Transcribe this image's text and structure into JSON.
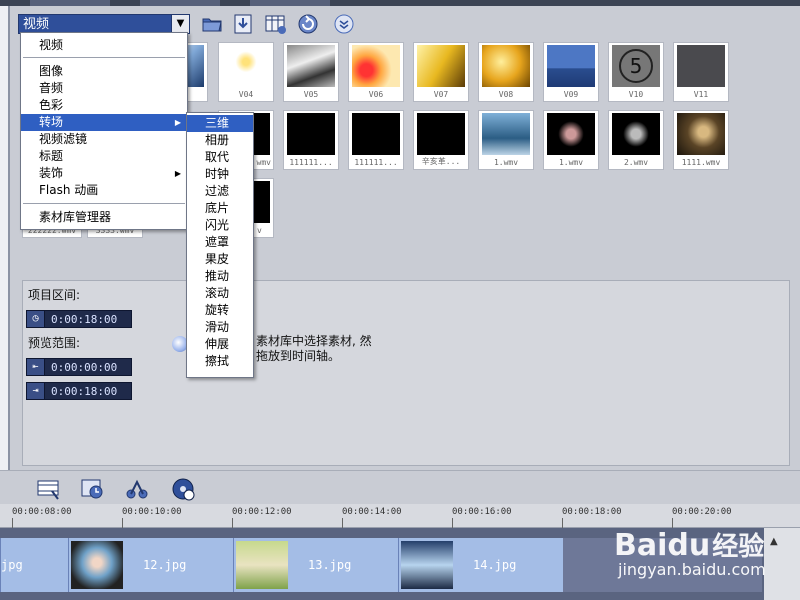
{
  "library": {
    "category": "视频",
    "thumbs_row1": [
      "V04",
      "V05",
      "V06",
      "V07",
      "V08",
      "V09",
      "V10",
      "V11"
    ],
    "thumbs_row2": [
      "111111...",
      "111111...",
      "辛亥革...",
      "1.wmv",
      "1.wmv",
      "2.wmv",
      "1111.wmv"
    ],
    "partial_labels": {
      "row2_left": "wmv",
      "row3_a": "222222.wmv",
      "row3_b": "3333.wmv",
      "row3_c": "v"
    },
    "v10_number": "5"
  },
  "category_menu": {
    "items": [
      {
        "label": "视频"
      },
      {
        "label": "图像"
      },
      {
        "label": "音频"
      },
      {
        "label": "色彩"
      },
      {
        "label": "转场",
        "submenu": true,
        "selected": true
      },
      {
        "label": "视频滤镜"
      },
      {
        "label": "标题"
      },
      {
        "label": "装饰",
        "submenu": true
      },
      {
        "label": "Flash 动画"
      },
      {
        "label": "素材库管理器"
      }
    ]
  },
  "transition_submenu": {
    "items": [
      "三维",
      "相册",
      "取代",
      "时钟",
      "过滤",
      "底片",
      "闪光",
      "遮罩",
      "果皮",
      "推动",
      "滚动",
      "旋转",
      "滑动",
      "伸展",
      "擦拭"
    ],
    "selected": "三维"
  },
  "properties": {
    "duration_label": "项目区间:",
    "duration_value": "0:00:18:00",
    "preview_label": "预览范围:",
    "preview_start": "0:00:00:00",
    "preview_end": "0:00:18:00",
    "hint_line1": "素材库中选择素材, 然",
    "hint_line2": "拖放到时间轴。"
  },
  "ruler": {
    "ticks": [
      "00:00:08:00",
      "00:00:10:00",
      "00:00:12:00",
      "00:00:14:00",
      "00:00:16:00",
      "00:00:18:00",
      "00:00:20:00"
    ]
  },
  "timeline": {
    "clips": [
      {
        "label": "jpg"
      },
      {
        "label": "12.jpg"
      },
      {
        "label": "13.jpg"
      },
      {
        "label": "14.jpg"
      }
    ]
  },
  "watermark": {
    "brand": "Baidu",
    "cn": "经验",
    "url": "jingyan.baidu.com"
  },
  "colors": {
    "menu_highlight": "#2f5fc2",
    "timecode_bg": "#1f2a4a",
    "clip_bg": "#a4bde6"
  }
}
